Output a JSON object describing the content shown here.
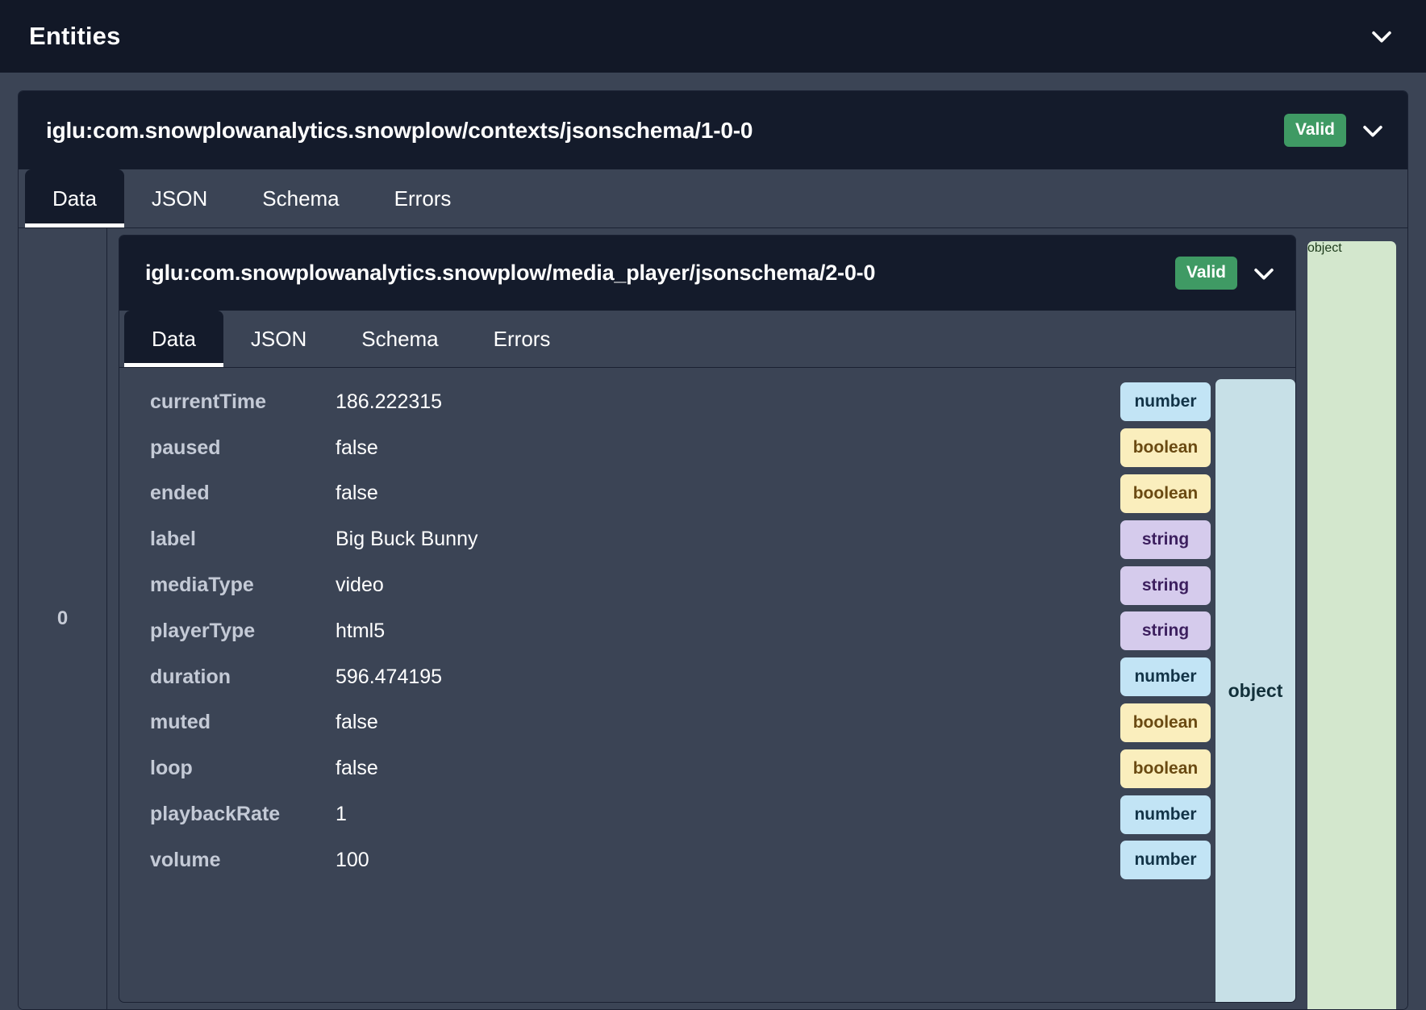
{
  "header": {
    "title": "Entities",
    "collapse_icon": "chevron-down-icon"
  },
  "outer_entity": {
    "schema": "iglu:com.snowplowanalytics.snowplow/contexts/jsonschema/1-0-0",
    "status_badge": "Valid",
    "status_color": "#3f9a64",
    "collapse_icon": "chevron-down-icon",
    "tabs": [
      {
        "label": "Data",
        "active": true
      },
      {
        "label": "JSON",
        "active": false
      },
      {
        "label": "Schema",
        "active": false
      },
      {
        "label": "Errors",
        "active": false
      }
    ],
    "index_label": "0",
    "type_label": "object",
    "type_color": "#d3e7cd"
  },
  "nested_entity": {
    "schema": "iglu:com.snowplowanalytics.snowplow/media_player/jsonschema/2-0-0",
    "status_badge": "Valid",
    "status_color": "#3f9a64",
    "collapse_icon": "chevron-down-icon",
    "tabs": [
      {
        "label": "Data",
        "active": true
      },
      {
        "label": "JSON",
        "active": false
      },
      {
        "label": "Schema",
        "active": false
      },
      {
        "label": "Errors",
        "active": false
      }
    ],
    "type_label": "object",
    "type_color": "#c7e0e7",
    "rows": [
      {
        "key": "currentTime",
        "value": "186.222315",
        "type": "number"
      },
      {
        "key": "paused",
        "value": "false",
        "type": "boolean"
      },
      {
        "key": "ended",
        "value": "false",
        "type": "boolean"
      },
      {
        "key": "label",
        "value": "Big Buck Bunny",
        "type": "string"
      },
      {
        "key": "mediaType",
        "value": "video",
        "type": "string"
      },
      {
        "key": "playerType",
        "value": "html5",
        "type": "string"
      },
      {
        "key": "duration",
        "value": "596.474195",
        "type": "number"
      },
      {
        "key": "muted",
        "value": "false",
        "type": "boolean"
      },
      {
        "key": "loop",
        "value": "false",
        "type": "boolean"
      },
      {
        "key": "playbackRate",
        "value": "1",
        "type": "number"
      },
      {
        "key": "volume",
        "value": "100",
        "type": "number"
      }
    ]
  },
  "colors": {
    "page_bg": "#3b4455",
    "header_bg": "#121827",
    "card_header_bg": "#141b2b",
    "border": "#1b2233",
    "badge_number": "#c2e4f5",
    "badge_boolean": "#faeebd",
    "badge_string": "#d5cbec"
  }
}
